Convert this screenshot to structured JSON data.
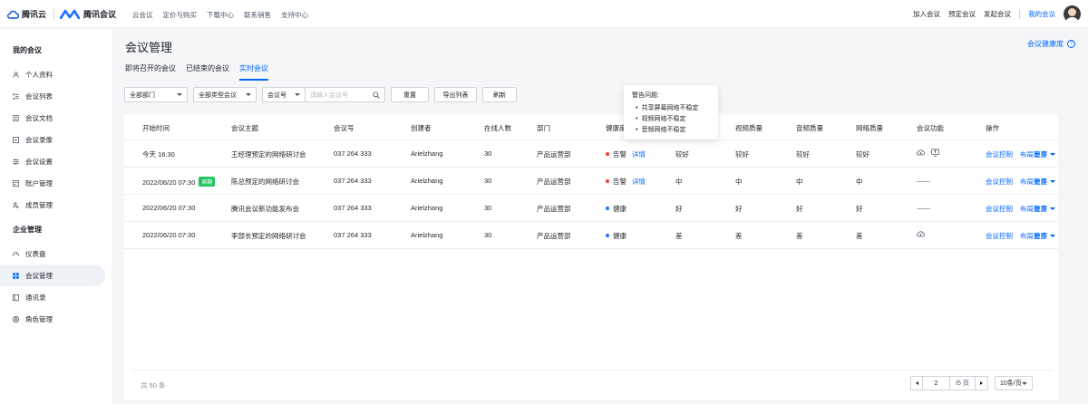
{
  "topbar": {
    "cloud_brand": "腾讯云",
    "meeting_brand": "腾讯会议",
    "nav": [
      "云会议",
      "定价与购买",
      "下载中心",
      "联系销售",
      "支持中心"
    ],
    "actions": [
      "加入会议",
      "预定会议",
      "发起会议"
    ],
    "my_meetings": "我的会议"
  },
  "sidebar": {
    "group1": "我的会议",
    "items1": [
      {
        "label": "个人资料",
        "icon": "user-icon"
      },
      {
        "label": "会议列表",
        "icon": "list-icon"
      },
      {
        "label": "会议文档",
        "icon": "document-icon"
      },
      {
        "label": "会议录像",
        "icon": "video-icon"
      },
      {
        "label": "会议设置",
        "icon": "settings-icon"
      },
      {
        "label": "账户管理",
        "icon": "account-icon"
      },
      {
        "label": "成员管理",
        "icon": "members-icon"
      }
    ],
    "group2": "企业管理",
    "items2": [
      {
        "label": "仪表盘",
        "icon": "dashboard-icon"
      },
      {
        "label": "会议管理",
        "icon": "grid-icon"
      },
      {
        "label": "通讯录",
        "icon": "contacts-icon"
      },
      {
        "label": "角色管理",
        "icon": "role-icon"
      }
    ]
  },
  "main": {
    "title": "会议管理",
    "health_link": "会议健康度",
    "tabs": [
      "即将召开的会议",
      "已结束的会议",
      "实时会议"
    ],
    "active_tab": 2
  },
  "filters": {
    "department": "全部部门",
    "type": "全部类型会议",
    "field": "会议号",
    "search_placeholder": "请输入会议号",
    "reset": "重置",
    "export": "导出列表",
    "refresh": "刷新"
  },
  "table": {
    "headers": [
      "开始时间",
      "会议主题",
      "会议号",
      "创建者",
      "在线人数",
      "部门",
      "健康度",
      "视频质量",
      "音频质量",
      "网络质量",
      "会议功能",
      "操作"
    ],
    "rows": [
      {
        "time": "今天 16:30",
        "tag": "",
        "topic": "王经理预定的网络研讨会",
        "id": "037 264 333",
        "creator": "Arielzhang",
        "online": "30",
        "dept": "产品运营部",
        "health": "告警",
        "health_color": "#f53f3f",
        "detail": "详情",
        "q_hidden": "较好",
        "video": "较好",
        "audio": "较好",
        "network": "较好",
        "features": [
          "cloud-record-icon",
          "screen-share-icon"
        ]
      },
      {
        "time": "2022/06/20  07:30",
        "tag": "周期",
        "topic": "陈总预定的网络研讨会",
        "id": "037 264 333",
        "creator": "Arielzhang",
        "online": "30",
        "dept": "产品运营部",
        "health": "告警",
        "health_color": "#f53f3f",
        "detail": "详情",
        "q_hidden": "中",
        "video": "中",
        "audio": "中",
        "network": "中",
        "features": [],
        "features_text": "——"
      },
      {
        "time": "2022/06/20  07:30",
        "tag": "",
        "topic": "腾讯会议新功能发布会",
        "id": "037 264 333",
        "creator": "Arielzhang",
        "online": "30",
        "dept": "产品运营部",
        "health": "健康",
        "health_color": "#1e6fff",
        "detail": "",
        "q_hidden": "好",
        "video": "好",
        "audio": "好",
        "network": "好",
        "features": [],
        "features_text": "——"
      },
      {
        "time": "2022/06/20  07:30",
        "tag": "",
        "topic": "李部长预定的网络研讨会",
        "id": "037 264 333",
        "creator": "Arielzhang",
        "online": "30",
        "dept": "产品运营部",
        "health": "健康",
        "health_color": "#1e6fff",
        "detail": "",
        "q_hidden": "差",
        "video": "差",
        "audio": "差",
        "network": "差",
        "features": [
          "cloud-record-icon"
        ]
      }
    ],
    "actions": {
      "control": "会议控制",
      "layout": "布局管理",
      "more": "更多"
    }
  },
  "pagination": {
    "total": "共 50 条",
    "page": "2",
    "pages": "/5 页",
    "page_size": "10条/页"
  },
  "tooltip": {
    "title": "警告问题:",
    "items": [
      "共享屏幕网络不稳定",
      "视频网络不稳定",
      "音频网络不稳定"
    ]
  }
}
